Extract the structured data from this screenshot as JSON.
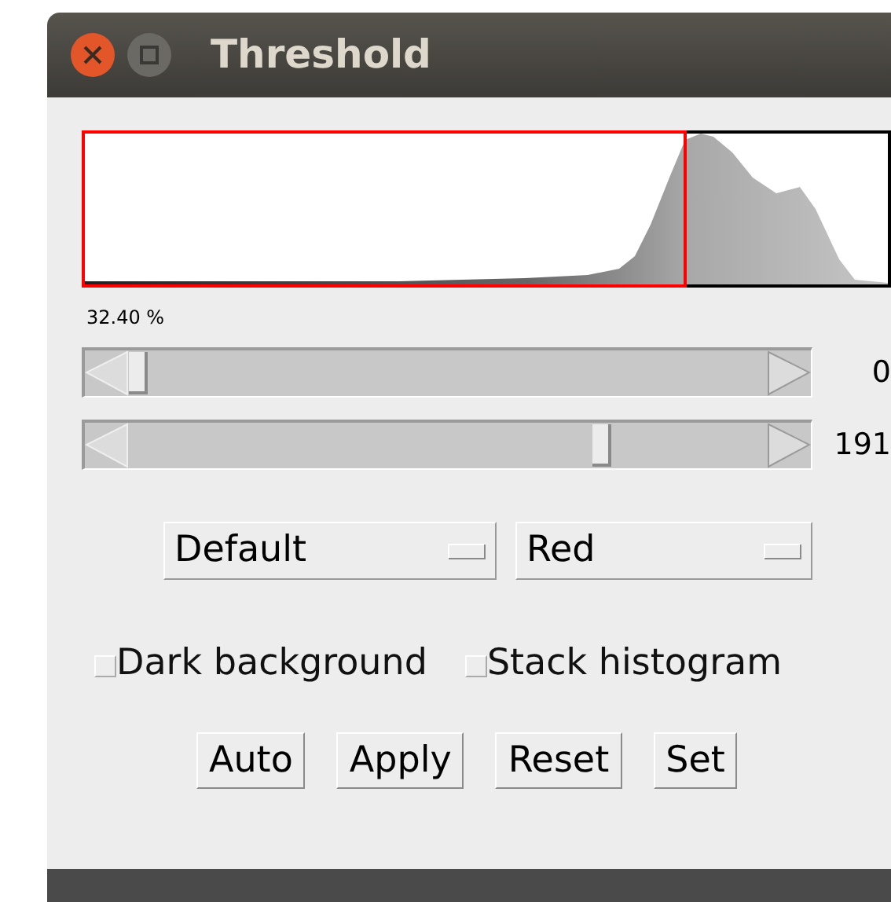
{
  "window": {
    "title": "Threshold"
  },
  "percentage": "32.40 %",
  "sliders": [
    {
      "level": 0,
      "reading": "0"
    },
    {
      "level": 0.75,
      "reading": "191"
    }
  ],
  "dropdowns": [
    {
      "value": "Default"
    },
    {
      "value": "Red"
    }
  ],
  "checkboxes": [
    {
      "label": "Dark background",
      "checked": false
    },
    {
      "label": "Stack histogram",
      "checked": false
    }
  ],
  "buttons": [
    "Auto",
    "Apply",
    "Reset",
    "Set"
  ]
}
